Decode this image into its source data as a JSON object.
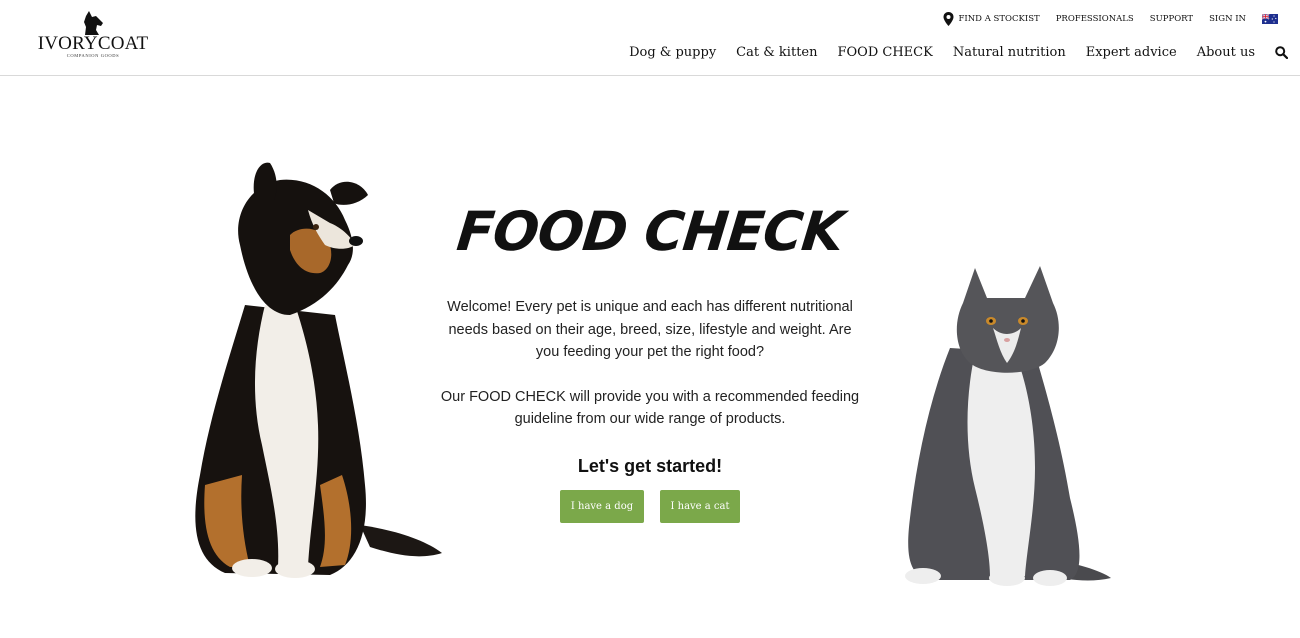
{
  "brand": {
    "name": "IVORYCOAT",
    "tagline": "COMPANION GOODS"
  },
  "utility_nav": {
    "find_stockist": "FIND A STOCKIST",
    "professionals": "PROFESSIONALS",
    "support": "SUPPORT",
    "sign_in": "SIGN IN",
    "flag_icon": "australia-flag-icon"
  },
  "main_nav": {
    "items": [
      "Dog & puppy",
      "Cat & kitten",
      "FOOD CHECK",
      "Natural nutrition",
      "Expert advice",
      "About us"
    ],
    "search_icon": "search-icon"
  },
  "hero": {
    "title": "FOOD CHECK",
    "intro": "Welcome! Every pet is unique and each has different nutritional needs based on their age, breed, size, lifestyle and weight. Are you feeding your pet the right food?",
    "description": "Our FOOD CHECK will provide you with a recommended feeding guideline from our wide range of products.",
    "cta": "Let's get started!",
    "dog_button": "I have a dog",
    "cat_button": "I have a cat"
  },
  "colors": {
    "button": "#7ba84a",
    "text": "#1a1a1a",
    "border": "#d9d9d9"
  }
}
